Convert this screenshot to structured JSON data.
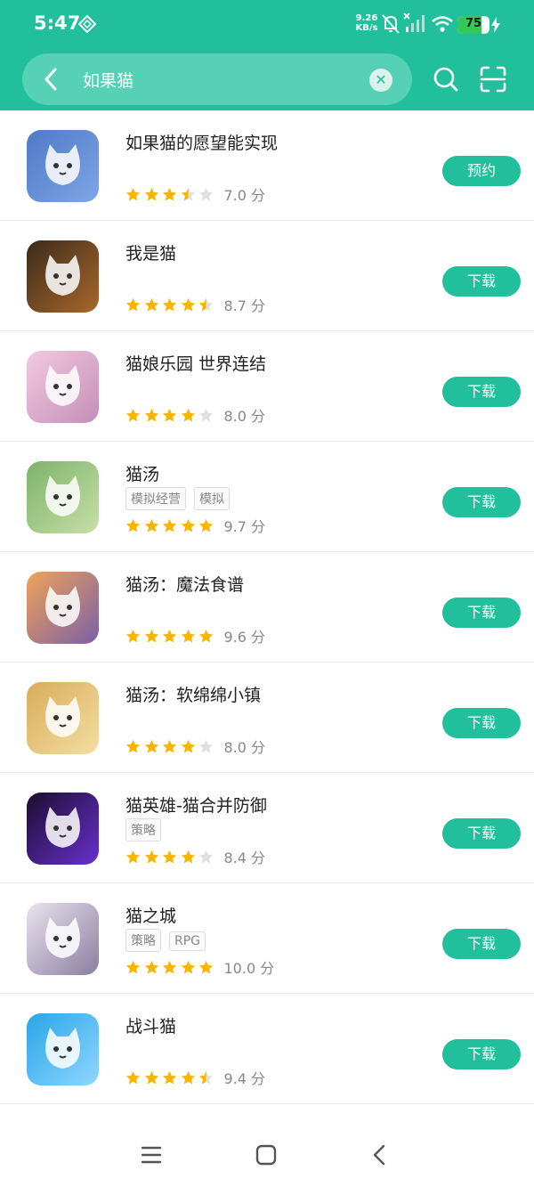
{
  "status_bar": {
    "time": "5:47",
    "net_speed_value": "9.26",
    "net_speed_unit": "KB/s",
    "battery": "75"
  },
  "search": {
    "query": "如果猫"
  },
  "results": [
    {
      "name": "如果猫的愿望能实现",
      "tags": [],
      "rating": 3.5,
      "score": "7.0 分",
      "action": "预约",
      "icon": "white-cat-app-icon",
      "colors": [
        "#4f79c7",
        "#7ea6e6"
      ]
    },
    {
      "name": "我是猫",
      "tags": [],
      "rating": 4.5,
      "score": "8.7 分",
      "action": "下载",
      "icon": "orange-cat-app-icon",
      "colors": [
        "#3b2a1c",
        "#a9682b"
      ]
    },
    {
      "name": "猫娘乐园 世界连结",
      "tags": [],
      "rating": 4,
      "score": "8.0 分",
      "action": "下载",
      "icon": "catgirl-app-icon",
      "colors": [
        "#f2c9df",
        "#c58fb8"
      ]
    },
    {
      "name": "猫汤",
      "tags": [
        "模拟经营",
        "模拟"
      ],
      "rating": 5,
      "score": "9.7 分",
      "action": "下载",
      "icon": "frog-cat-app-icon",
      "colors": [
        "#7db36a",
        "#c8dfa6"
      ]
    },
    {
      "name": "猫汤：魔法食谱",
      "tags": [],
      "rating": 5,
      "score": "9.6 分",
      "action": "下载",
      "icon": "witch-cat-app-icon",
      "colors": [
        "#f0a357",
        "#7b5fa6"
      ]
    },
    {
      "name": "猫汤：软绵绵小镇",
      "tags": [],
      "rating": 4,
      "score": "8.0 分",
      "action": "下载",
      "icon": "farmer-cat-app-icon",
      "colors": [
        "#d9ac5a",
        "#f3dfa3"
      ]
    },
    {
      "name": "猫英雄-猫合并防御",
      "tags": [
        "策略"
      ],
      "rating": 4,
      "score": "8.4 分",
      "action": "下载",
      "icon": "neon-cat-app-icon",
      "colors": [
        "#1a0d2e",
        "#6a2fd0"
      ]
    },
    {
      "name": "猫之城",
      "tags": [
        "策略",
        "RPG"
      ],
      "rating": 5,
      "score": "10.0 分",
      "action": "下载",
      "icon": "anime-character-app-icon",
      "colors": [
        "#e9e3ee",
        "#8a7fa0"
      ]
    },
    {
      "name": "战斗猫",
      "tags": [],
      "rating": 4.5,
      "score": "9.4 分",
      "action": "下载",
      "icon": "battle-cat-app-icon",
      "colors": [
        "#29a5e8",
        "#8fd7ff"
      ]
    }
  ],
  "theme": {
    "accent": "#22bf9d",
    "star": "#f7b500",
    "star_empty": "#e0e0e0"
  }
}
